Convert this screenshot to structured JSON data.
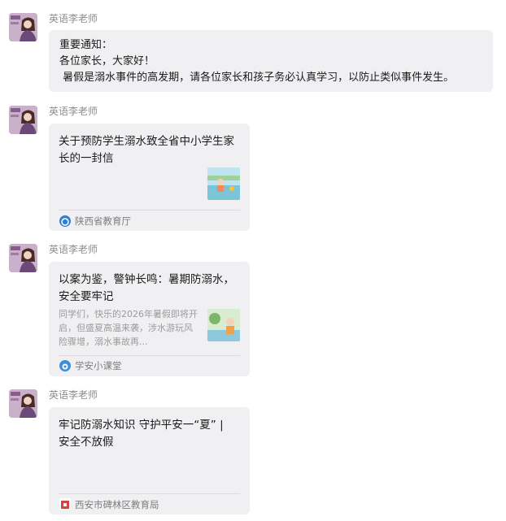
{
  "messages": [
    {
      "sender": "英语李老师",
      "lines": [
        "重要通知：",
        "各位家长，大家好！",
        " 暑假是溺水事件的高发期，请各位家长和孩子务必认真学习，以防止类似事件发生。"
      ]
    },
    {
      "sender": "英语李老师",
      "card": {
        "title": "关于预防学生溺水致全省中小学生家长的一封信",
        "source": "陕西省教育厅"
      }
    },
    {
      "sender": "英语李老师",
      "card": {
        "title": "以案为鉴，警钟长鸣：暑期防溺水，安全要牢记",
        "description": "同学们，快乐的2026年暑假即将开启，但盛夏高温来袭，涉水游玩风险骤增，溺水事故再...",
        "source": "学安小课堂"
      }
    },
    {
      "sender": "英语李老师",
      "card": {
        "title": "牢记防溺水知识 守护平安一“夏” | 安全不放假",
        "source": "西安市碑林区教育局"
      }
    }
  ],
  "colors": {
    "bubble": "#f0f0f3",
    "sender": "#8c8c8c",
    "source_text": "#7d7d7d",
    "description": "#9b9b9b"
  },
  "icons": {
    "avatar": "teacher-avatar-icon",
    "source_1": "shaanxi-education-logo-icon",
    "source_2": "xuean-classroom-logo-icon",
    "source_3": "beilin-education-logo-icon"
  }
}
